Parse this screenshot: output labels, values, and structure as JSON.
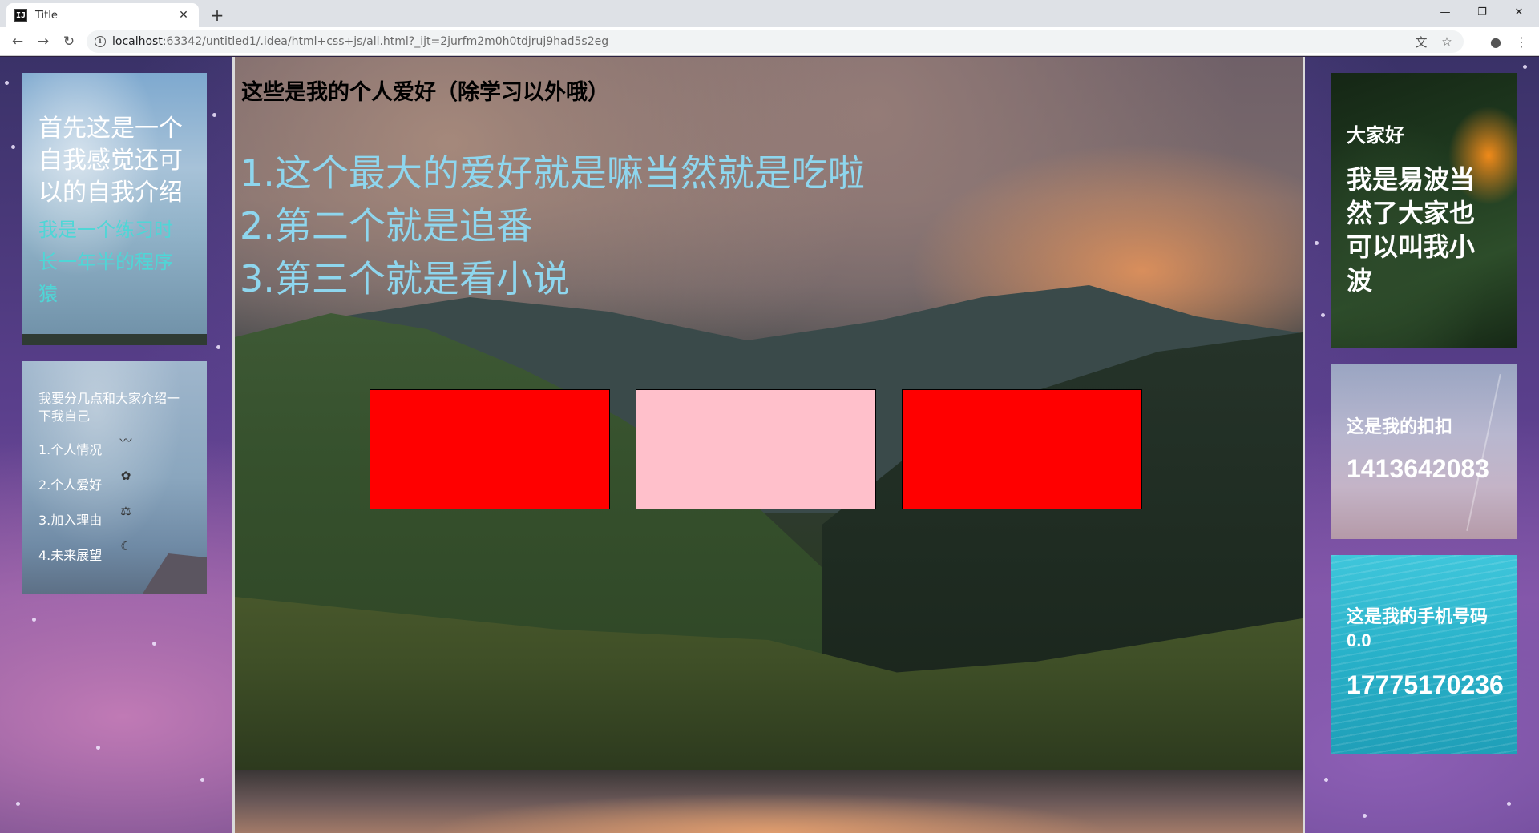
{
  "browser": {
    "tab_title": "Title",
    "tab_favicon": "IJ",
    "url_host": "localhost",
    "url_rest": ":63342/untitled1/.idea/html+css+js/all.html?_ijt=2jurfm2m0h0tdjruj9had5s2eg",
    "icons": {
      "back": "arrow-left-icon",
      "forward": "arrow-right-icon",
      "reload": "reload-icon",
      "info": "info-icon",
      "translate": "translate-icon",
      "bookmark": "star-icon",
      "profile": "account-icon",
      "menu": "kebab-menu-icon"
    }
  },
  "left": {
    "intro_title": "首先这是一个自我感觉还可以的自我介绍",
    "intro_sub": "我是一个练习时长一年半的程序猿",
    "outline_heading": "我要分几点和大家介绍一下我自己",
    "outline_items": [
      {
        "label": "1.个人情况",
        "icon": "mustache-icon"
      },
      {
        "label": "2.个人爱好",
        "icon": "rose-icon"
      },
      {
        "label": "3.加入理由",
        "icon": "scale-icon"
      },
      {
        "label": "4.未来展望",
        "icon": "moon-icon"
      }
    ]
  },
  "center": {
    "heading": "这些是我的个人爱好（除学习以外哦）",
    "hobbies": [
      "1.这个最大的爱好就是嘛当然就是吃啦",
      "2.第二个就是追番",
      "3.第三个就是看小说"
    ],
    "box_colors": [
      "#ff0000",
      "#ffc0cb",
      "#ff0000"
    ]
  },
  "right": {
    "greeting": "大家好",
    "name_intro": "我是易波当然了大家也可以叫我小波",
    "qq_label": "这是我的扣扣",
    "qq_number": "1413642083",
    "phone_label": "这是我的手机号码0.0",
    "phone_number": "17775170236"
  },
  "colors": {
    "hobby_text": "#8ed6ee",
    "intro_sub_text": "#4fd6d6"
  }
}
